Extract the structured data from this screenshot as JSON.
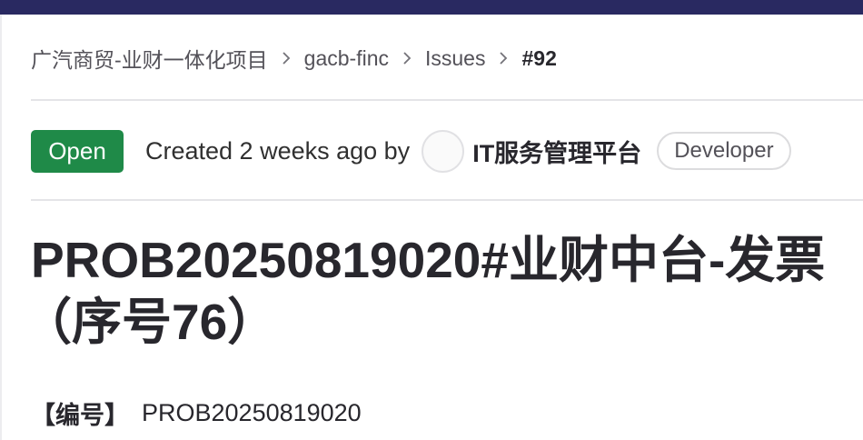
{
  "breadcrumb": {
    "items": [
      "广汽商贸-业财一体化项目",
      "gacb-finc",
      "Issues",
      "#92"
    ]
  },
  "issue": {
    "status": "Open",
    "created_text": "Created 2 weeks ago by",
    "author": "IT服务管理平台",
    "role": "Developer",
    "title_line1": "PROB20250819020#业财中台-发票",
    "title_line2": "（序号76）"
  },
  "description": {
    "field_label": "【编号】",
    "field_value": "PROB20250819020"
  },
  "colors": {
    "topbar": "#292961",
    "status_open": "#1f8a48"
  },
  "icons": {
    "separator": "chevron-right-icon"
  }
}
